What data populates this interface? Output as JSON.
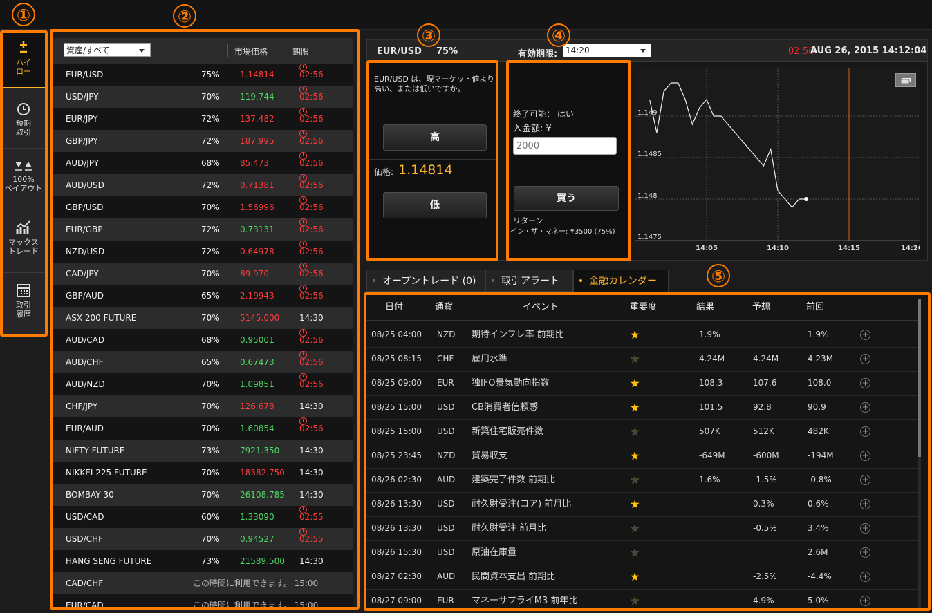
{
  "sidebar": {
    "items": [
      {
        "label": "ハイ\nロー",
        "icon": "plus-minus-icon"
      },
      {
        "label": "短期\n取引",
        "icon": "clock-icon"
      },
      {
        "label": "100%\nペイアウト",
        "icon": "triangles-icon"
      },
      {
        "label": "マックス\nトレード",
        "icon": "chart-up-icon"
      },
      {
        "label": "取引\n履歴",
        "icon": "calendar-icon"
      }
    ]
  },
  "annotations": [
    "①",
    "②",
    "③",
    "④",
    "⑤"
  ],
  "assets": {
    "filter_value": "資産/すべて",
    "col_price": "市場価格",
    "col_expiry": "期限",
    "rows": [
      {
        "name": "EUR/USD",
        "payout": "75%",
        "price": "1.14814",
        "price_color": "red",
        "expiry": "02:56",
        "clock": true
      },
      {
        "name": "USD/JPY",
        "payout": "70%",
        "price": "119.744",
        "price_color": "green",
        "expiry": "02:56",
        "clock": true
      },
      {
        "name": "EUR/JPY",
        "payout": "72%",
        "price": "137.482",
        "price_color": "red",
        "expiry": "02:56",
        "clock": true
      },
      {
        "name": "GBP/JPY",
        "payout": "72%",
        "price": "187.995",
        "price_color": "red",
        "expiry": "02:56",
        "clock": true
      },
      {
        "name": "AUD/JPY",
        "payout": "68%",
        "price": "85.473",
        "price_color": "red",
        "expiry": "02:56",
        "clock": true
      },
      {
        "name": "AUD/USD",
        "payout": "72%",
        "price": "0.71381",
        "price_color": "red",
        "expiry": "02:56",
        "clock": true
      },
      {
        "name": "GBP/USD",
        "payout": "70%",
        "price": "1.56996",
        "price_color": "red",
        "expiry": "02:56",
        "clock": true
      },
      {
        "name": "EUR/GBP",
        "payout": "72%",
        "price": "0.73131",
        "price_color": "green",
        "expiry": "02:56",
        "clock": true
      },
      {
        "name": "NZD/USD",
        "payout": "72%",
        "price": "0.64978",
        "price_color": "red",
        "expiry": "02:56",
        "clock": true
      },
      {
        "name": "CAD/JPY",
        "payout": "70%",
        "price": "89.970",
        "price_color": "red",
        "expiry": "02:56",
        "clock": true
      },
      {
        "name": "GBP/AUD",
        "payout": "65%",
        "price": "2.19943",
        "price_color": "red",
        "expiry": "02:56",
        "clock": true
      },
      {
        "name": "ASX 200 FUTURE",
        "payout": "70%",
        "price": "5145.000",
        "price_color": "red",
        "expiry": "14:30",
        "clock": false
      },
      {
        "name": "AUD/CAD",
        "payout": "68%",
        "price": "0.95001",
        "price_color": "green",
        "expiry": "02:56",
        "clock": true
      },
      {
        "name": "AUD/CHF",
        "payout": "65%",
        "price": "0.67473",
        "price_color": "green",
        "expiry": "02:56",
        "clock": true
      },
      {
        "name": "AUD/NZD",
        "payout": "70%",
        "price": "1.09851",
        "price_color": "green",
        "expiry": "02:56",
        "clock": true
      },
      {
        "name": "CHF/JPY",
        "payout": "70%",
        "price": "126.678",
        "price_color": "red",
        "expiry": "14:30",
        "clock": false
      },
      {
        "name": "EUR/AUD",
        "payout": "70%",
        "price": "1.60854",
        "price_color": "green",
        "expiry": "02:56",
        "clock": true
      },
      {
        "name": "NIFTY FUTURE",
        "payout": "73%",
        "price": "7921.350",
        "price_color": "green",
        "expiry": "14:30",
        "clock": false
      },
      {
        "name": "NIKKEI 225 FUTURE",
        "payout": "70%",
        "price": "18382.750",
        "price_color": "red",
        "expiry": "14:30",
        "clock": false
      },
      {
        "name": "BOMBAY 30",
        "payout": "70%",
        "price": "26108.785",
        "price_color": "green",
        "expiry": "14:30",
        "clock": false
      },
      {
        "name": "USD/CAD",
        "payout": "60%",
        "price": "1.33090",
        "price_color": "green",
        "expiry": "02:55",
        "clock": true
      },
      {
        "name": "USD/CHF",
        "payout": "70%",
        "price": "0.94527",
        "price_color": "green",
        "expiry": "02:55",
        "clock": true
      },
      {
        "name": "HANG SENG FUTURE",
        "payout": "73%",
        "price": "21589.500",
        "price_color": "green",
        "expiry": "14:30",
        "clock": false
      },
      {
        "name": "CAD/CHF",
        "unavailable": "この時間に利用できます。 15:00"
      },
      {
        "name": "EUR/CAD",
        "unavailable": "この時間に利用できます。 15:00"
      }
    ]
  },
  "trade": {
    "pair": "EUR/USD",
    "payout": "75%",
    "expiry_label": "有効期限:",
    "expiry_value": "14:20",
    "countdown": "02:56",
    "datetime": "AUG 26, 2015 14:12:04",
    "question": "EUR/USD は、現マーケット値より高い、または低いですか。",
    "high_label": "高",
    "low_label": "低",
    "price_label": "価格:",
    "price_value": "1.14814",
    "close_possible": "終了可能： はい",
    "deposit_label": "入金額: ¥",
    "amount_placeholder": "2000",
    "buy_label": "買う",
    "return_label": "リターン",
    "return_value": "イン・ザ・マネー: ¥3500 (75%)"
  },
  "chart_data": {
    "type": "line",
    "y_ticks": [
      "1.149",
      "1.1485",
      "1.148",
      "1.1475"
    ],
    "x_ticks": [
      "14:05",
      "14:10",
      "14:15",
      "14:20"
    ],
    "ylim": [
      1.1475,
      1.1495
    ],
    "x": [
      "14:01:00",
      "14:01:30",
      "14:02:00",
      "14:02:30",
      "14:03:00",
      "14:03:30",
      "14:04:00",
      "14:04:30",
      "14:05:00",
      "14:05:30",
      "14:06:00",
      "14:06:30",
      "14:07:00",
      "14:07:30",
      "14:08:00",
      "14:08:30",
      "14:09:00",
      "14:09:30",
      "14:10:00",
      "14:10:30",
      "14:11:00",
      "14:11:30",
      "14:12:00"
    ],
    "values": [
      1.1492,
      1.1488,
      1.1493,
      1.1494,
      1.1494,
      1.1492,
      1.1489,
      1.1491,
      1.1492,
      1.149,
      1.149,
      1.1489,
      1.1488,
      1.1487,
      1.1486,
      1.1485,
      1.1484,
      1.1486,
      1.1481,
      1.148,
      1.1479,
      1.148,
      1.148
    ]
  },
  "tabs": [
    {
      "label": "オープントレード (0)",
      "active": false
    },
    {
      "label": "取引アラート",
      "active": false
    },
    {
      "label": "金融カレンダー",
      "active": true
    }
  ],
  "calendar": {
    "headers": [
      "日付",
      "通貨",
      "イベント",
      "重要度",
      "結果",
      "予想",
      "前回"
    ],
    "rows": [
      {
        "date": "08/25 04:00",
        "cur": "NZD",
        "event": "期待インフレ率 前期比",
        "stars": 3,
        "result": "1.9%",
        "forecast": "",
        "previous": "1.9%"
      },
      {
        "date": "08/25 08:15",
        "cur": "CHF",
        "event": "雇用水準",
        "stars": 2,
        "result": "4.24M",
        "forecast": "4.24M",
        "previous": "4.23M"
      },
      {
        "date": "08/25 09:00",
        "cur": "EUR",
        "event": "独IFO景気動向指数",
        "stars": 3,
        "result": "108.3",
        "forecast": "107.6",
        "previous": "108.0"
      },
      {
        "date": "08/25 15:00",
        "cur": "USD",
        "event": "CB消費者信頼感",
        "stars": 3,
        "result": "101.5",
        "forecast": "92.8",
        "previous": "90.9"
      },
      {
        "date": "08/25 15:00",
        "cur": "USD",
        "event": "新築住宅販売件数",
        "stars": 2,
        "result": "507K",
        "forecast": "512K",
        "previous": "482K"
      },
      {
        "date": "08/25 23:45",
        "cur": "NZD",
        "event": "貿易収支",
        "stars": 3,
        "result": "-649M",
        "forecast": "-600M",
        "previous": "-194M"
      },
      {
        "date": "08/26 02:30",
        "cur": "AUD",
        "event": "建築完了件数 前期比",
        "stars": 2,
        "result": "1.6%",
        "forecast": "-1.5%",
        "previous": "-0.8%"
      },
      {
        "date": "08/26 13:30",
        "cur": "USD",
        "event": "耐久財受注(コア) 前月比",
        "stars": 3,
        "result": "",
        "forecast": "0.3%",
        "previous": "0.6%"
      },
      {
        "date": "08/26 13:30",
        "cur": "USD",
        "event": "耐久財受注 前月比",
        "stars": 2,
        "result": "",
        "forecast": "-0.5%",
        "previous": "3.4%"
      },
      {
        "date": "08/26 15:30",
        "cur": "USD",
        "event": "原油在庫量",
        "stars": 2,
        "result": "",
        "forecast": "",
        "previous": "2.6M"
      },
      {
        "date": "08/27 02:30",
        "cur": "AUD",
        "event": "民間資本支出 前期比",
        "stars": 3,
        "result": "",
        "forecast": "-2.5%",
        "previous": "-4.4%"
      },
      {
        "date": "08/27 09:00",
        "cur": "EUR",
        "event": "マネーサプライM3 前年比",
        "stars": 2,
        "result": "",
        "forecast": "4.9%",
        "previous": "5.0%"
      }
    ]
  }
}
